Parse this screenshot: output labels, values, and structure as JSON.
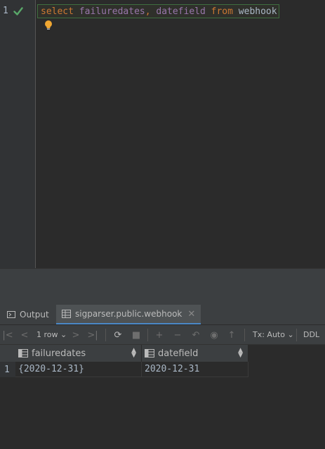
{
  "editor": {
    "line_number": "1",
    "code": {
      "kw_select": "select",
      "col_failuredates": "failuredates",
      "comma": ",",
      "col_datefield": "datefield",
      "kw_from": "from",
      "table": "webhook"
    }
  },
  "tabs": {
    "output_label": "Output",
    "webhook_label": "sigparser.public.webhook"
  },
  "toolbar": {
    "rows_label": "1 row",
    "tx_label": "Tx: Auto",
    "ddl_label": "DDL"
  },
  "grid": {
    "columns": [
      "failuredates",
      "datefield"
    ],
    "rows": [
      {
        "row_number": "1",
        "failuredates": "{2020-12-31}",
        "datefield": "2020-12-31"
      }
    ]
  },
  "colors": {
    "keyword": "#cc7832",
    "column": "#9876aa",
    "identifier": "#a9b7c6",
    "success": "#59a869",
    "bulb": "#f0a732"
  }
}
